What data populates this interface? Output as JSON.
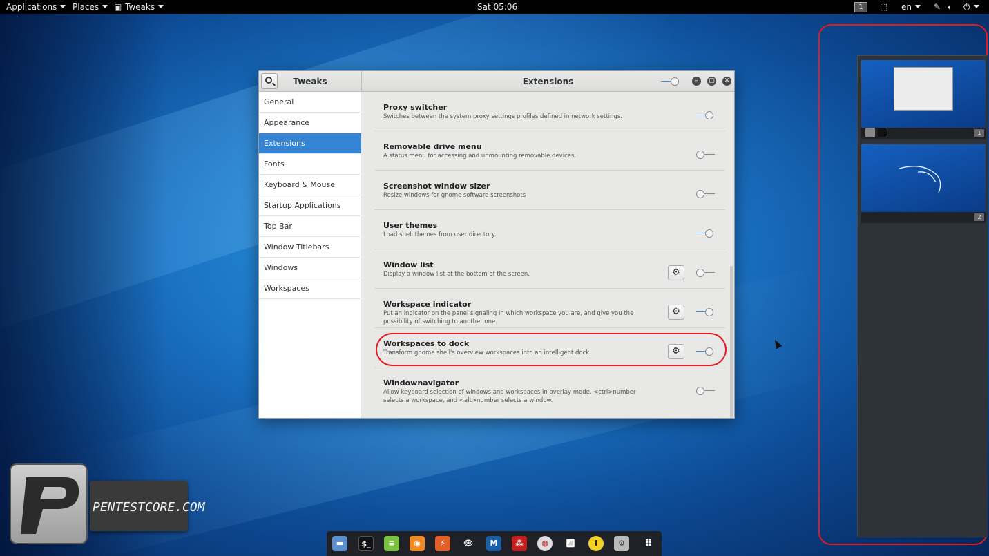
{
  "topbar": {
    "applications": "Applications",
    "places": "Places",
    "tweaks": "Tweaks",
    "clock": "Sat 05:06",
    "workspace_number": "1",
    "language": "en"
  },
  "window": {
    "left_title": "Tweaks",
    "main_title": "Extensions"
  },
  "sidebar": {
    "items": [
      {
        "label": "General"
      },
      {
        "label": "Appearance"
      },
      {
        "label": "Extensions"
      },
      {
        "label": "Fonts"
      },
      {
        "label": "Keyboard & Mouse"
      },
      {
        "label": "Startup Applications"
      },
      {
        "label": "Top Bar"
      },
      {
        "label": "Window Titlebars"
      },
      {
        "label": "Windows"
      },
      {
        "label": "Workspaces"
      }
    ],
    "selected": "Extensions"
  },
  "extensions": [
    {
      "name": "Proxy switcher",
      "desc": "Switches between the system proxy settings profiles defined in network settings.",
      "enabled": true,
      "has_settings": false
    },
    {
      "name": "Removable drive menu",
      "desc": "A status menu for accessing and unmounting removable devices.",
      "enabled": false,
      "has_settings": false
    },
    {
      "name": "Screenshot window sizer",
      "desc": "Resize windows for gnome software screenshots",
      "enabled": false,
      "has_settings": false
    },
    {
      "name": "User themes",
      "desc": "Load shell themes from user directory.",
      "enabled": true,
      "has_settings": false
    },
    {
      "name": "Window list",
      "desc": "Display a window list at the bottom of the screen.",
      "enabled": false,
      "has_settings": true
    },
    {
      "name": "Workspace indicator",
      "desc": "Put an indicator on the panel signaling in which workspace you are, and give you the possibility of switching to another one.",
      "enabled": true,
      "has_settings": true
    },
    {
      "name": "Workspaces to dock",
      "desc": "Transform gnome shell's overview workspaces into an intelligent dock.",
      "enabled": true,
      "has_settings": true
    },
    {
      "name": "Windownavigator",
      "desc": "Allow keyboard selection of windows and workspaces in overlay mode. <ctrl>number selects a workspace, and <alt>number selects a window.",
      "enabled": false,
      "has_settings": false
    }
  ],
  "workspaces_dock": {
    "workspaces": [
      {
        "number": "1"
      },
      {
        "number": "2"
      }
    ]
  },
  "logo": {
    "text": "PENTESTCORE.COM"
  },
  "colors": {
    "selection": "#3584d4",
    "highlight": "#e21b1b"
  }
}
